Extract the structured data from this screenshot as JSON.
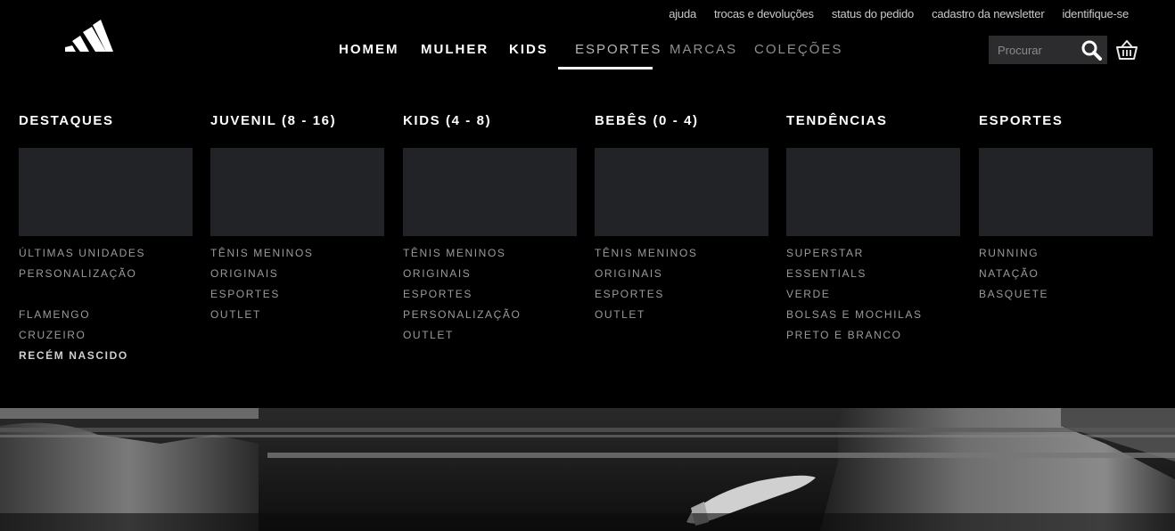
{
  "utility_links": [
    "ajuda",
    "trocas e devoluções",
    "status do pedido",
    "cadastro da newsletter",
    "identifique-se"
  ],
  "nav": {
    "home": "HOMEM",
    "mulher": "MULHER",
    "kids": "KIDS",
    "esportes": "ESPORTES",
    "marcas": "MARCAS",
    "colecoes": "COLEÇÕES"
  },
  "search": {
    "placeholder": "Procurar"
  },
  "icons": {
    "search": "search-icon",
    "basket": "basket-icon",
    "logo": "adidas-logo"
  },
  "menu": {
    "destaques": {
      "title": "DESTAQUES",
      "links": [
        "ÚLTIMAS UNIDADES",
        "PERSONALIZAÇÃO",
        "",
        "FLAMENGO",
        "CRUZEIRO",
        "RECÉM NASCIDO"
      ]
    },
    "juvenil": {
      "title": "JUVENIL (8 - 16)",
      "links": [
        "TÊNIS MENINOS",
        "ORIGINAIS",
        "ESPORTES",
        "OUTLET"
      ]
    },
    "kids": {
      "title": "KIDS (4 - 8)",
      "links": [
        "TÊNIS MENINOS",
        "ORIGINAIS",
        "ESPORTES",
        "PERSONALIZAÇÃO",
        "OUTLET"
      ]
    },
    "bebes": {
      "title": "BEBÊS (0 - 4)",
      "links": [
        "TÊNIS MENINOS",
        "ORIGINAIS",
        "ESPORTES",
        "OUTLET"
      ]
    },
    "tendencias": {
      "title": "TENDÊNCIAS",
      "links": [
        "SUPERSTAR",
        "ESSENTIALS",
        "VERDE",
        "BOLSAS E MOCHILAS",
        "PRETO E BRANCO"
      ]
    },
    "esportes": {
      "title": "ESPORTES",
      "links": [
        "RUNNING",
        "NATAÇÃO",
        "BASQUETE"
      ]
    }
  },
  "colors": {
    "background": "#000000",
    "panel": "#222327",
    "search_bg": "#2c2c2e"
  }
}
